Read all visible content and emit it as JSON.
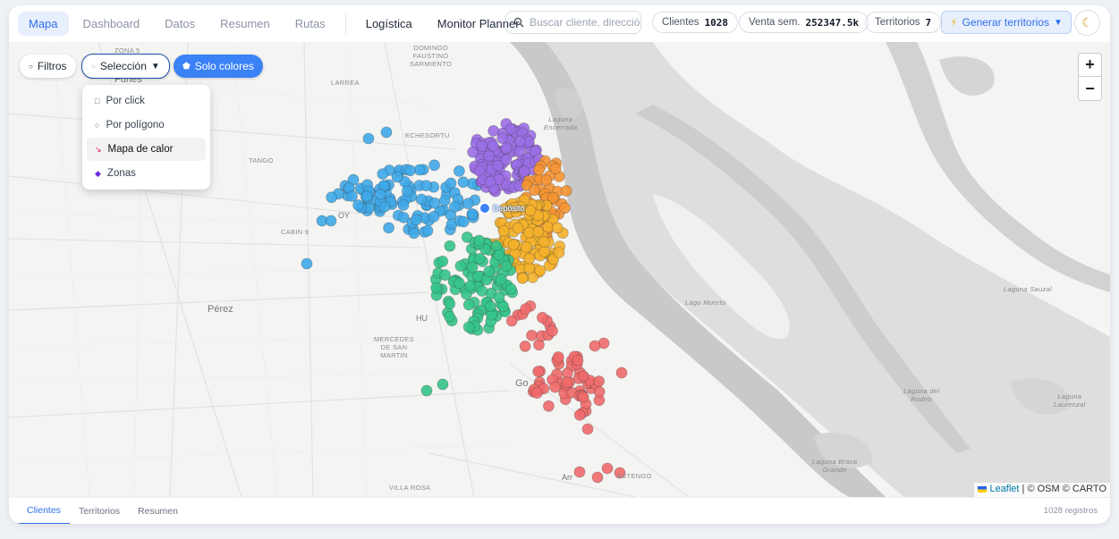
{
  "nav": {
    "tabs": [
      "Mapa",
      "Dashboard",
      "Datos",
      "Resumen",
      "Rutas"
    ],
    "extra": [
      "Logística",
      "Monitor Planner"
    ],
    "active": "Mapa"
  },
  "search": {
    "placeholder": "Buscar cliente, dirección"
  },
  "stats": {
    "clientes_label": "Clientes",
    "clientes_value": "1028",
    "venta_label": "Venta sem.",
    "venta_value": "252347.5k",
    "territorios_label": "Territorios",
    "territorios_value": "7"
  },
  "generate": {
    "label": "Generar territorios"
  },
  "icons": {
    "theme": "moon-icon",
    "generate": "lightning-icon",
    "search": "search-icon"
  },
  "map_controls": {
    "filtros": "Filtros",
    "seleccion": "Selección",
    "solo_colores": "Solo colores",
    "menu": [
      "Por click",
      "Por polígono",
      "Mapa de calor",
      "Zonas"
    ],
    "highlighted": "Mapa de calor"
  },
  "map_labels": {
    "zona5": "ZONA 5",
    "domingo": [
      "DOMINGO",
      "FAUSTINO",
      "SARMIENTO"
    ],
    "funes": "Funes",
    "larrea": "LARREA",
    "echesortu": "ECHESORTU",
    "tango": "TANGO",
    "cabin9": "CABIN 9",
    "perez": "Pérez",
    "mercedes": [
      "MERCEDES",
      "DE SAN",
      "MARTIN"
    ],
    "villarosa": "VILLA ROSA",
    "astengo": "ASTENGO",
    "laguna_encerrada": [
      "Laguna",
      "Encerrada"
    ],
    "lago_muerto": "Lago Muerto",
    "laguna_sauzal": "Laguna Sauzal",
    "laguna_rodeo": [
      "Laguna del",
      "Rodeo"
    ],
    "laguna_laurenzal": [
      "Laguna",
      "Laurenzal"
    ],
    "laguna_brava": [
      "Laguna Brava",
      "Grande"
    ],
    "depot": "Depósito",
    "oy": "OY",
    "hu": "HU",
    "go": "Go",
    "ar": "Arr"
  },
  "attribution": {
    "leaflet": "Leaflet",
    "rest": "| © OSM © CARTO"
  },
  "bottom": {
    "tabs": [
      "Clientes",
      "Territorios",
      "Resumen"
    ],
    "count": "1028 registros"
  },
  "colors": {
    "blue": "#3fa9e8",
    "purple": "#9b6ee6",
    "orange": "#f59332",
    "yellow": "#f5b12b",
    "green": "#35c48a",
    "red": "#ef6a6a",
    "accent": "#2f6fea"
  }
}
